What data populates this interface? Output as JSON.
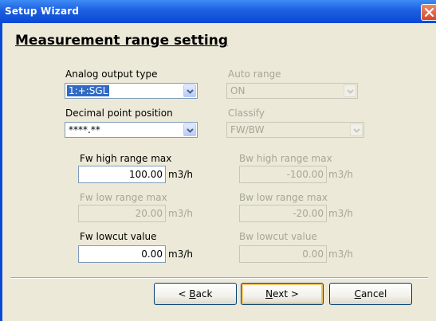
{
  "window": {
    "title": "Setup Wizard"
  },
  "heading": "Measurement range setting",
  "analog_output": {
    "label": "Analog output type",
    "value": "1:+:SGL"
  },
  "auto_range": {
    "label": "Auto range",
    "value": "ON"
  },
  "decimal_point": {
    "label": "Decimal point position",
    "value": "****.**"
  },
  "classify": {
    "label": "Classify",
    "value": "FW/BW"
  },
  "fw_high": {
    "label": "Fw high range max",
    "value": "100.00",
    "unit": "m3/h"
  },
  "bw_high": {
    "label": "Bw high range max",
    "value": "-100.00",
    "unit": "m3/h"
  },
  "fw_low": {
    "label": "Fw low range max",
    "value": "20.00",
    "unit": "m3/h"
  },
  "bw_low": {
    "label": "Bw low range max",
    "value": "-20.00",
    "unit": "m3/h"
  },
  "fw_lowcut": {
    "label": "Fw lowcut value",
    "value": "0.00",
    "unit": "m3/h"
  },
  "bw_lowcut": {
    "label": "Bw lowcut value",
    "value": "0.00",
    "unit": "m3/h"
  },
  "buttons": {
    "back": {
      "prefix": "< ",
      "accel": "B",
      "rest": "ack"
    },
    "next": {
      "accel": "N",
      "rest": "ext >"
    },
    "cancel": {
      "accel": "C",
      "rest": "ancel"
    }
  },
  "icons": {
    "close": "close-icon",
    "dropdown": "chevron-down-icon"
  }
}
